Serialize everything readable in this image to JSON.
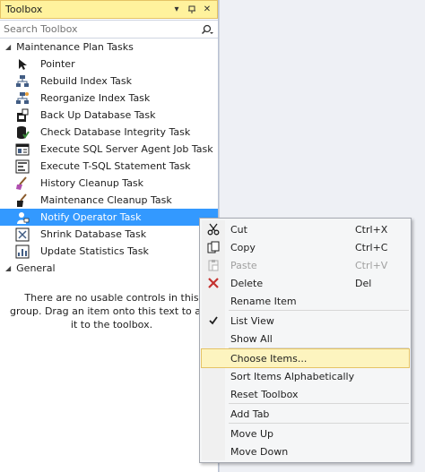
{
  "toolbox": {
    "title": "Toolbox",
    "pin_icon": "pin-icon",
    "close_label": "✕",
    "dropdown_label": "▾",
    "search": {
      "placeholder": "Search Toolbox"
    },
    "groups": [
      {
        "name": "Maintenance Plan Tasks",
        "items": [
          {
            "label": "Pointer",
            "icon": "pointer-icon"
          },
          {
            "label": "Rebuild Index Task",
            "icon": "rebuild-index-icon"
          },
          {
            "label": "Reorganize Index Task",
            "icon": "reorganize-index-icon"
          },
          {
            "label": "Back Up Database Task",
            "icon": "backup-database-icon"
          },
          {
            "label": "Check Database Integrity Task",
            "icon": "check-integrity-icon"
          },
          {
            "label": "Execute SQL Server Agent Job Task",
            "icon": "agent-job-icon"
          },
          {
            "label": "Execute T-SQL Statement Task",
            "icon": "tsql-icon"
          },
          {
            "label": "History Cleanup Task",
            "icon": "history-cleanup-icon"
          },
          {
            "label": "Maintenance Cleanup Task",
            "icon": "maintenance-cleanup-icon"
          },
          {
            "label": "Notify Operator Task",
            "icon": "notify-operator-icon",
            "selected": true
          },
          {
            "label": "Shrink Database Task",
            "icon": "shrink-database-icon"
          },
          {
            "label": "Update Statistics Task",
            "icon": "update-statistics-icon"
          }
        ]
      },
      {
        "name": "General",
        "empty_message": "There are no usable controls in this group. Drag an item onto this text to add it to the toolbox."
      }
    ]
  },
  "context_menu": {
    "items": [
      {
        "label": "Cut",
        "shortcut": "Ctrl+X",
        "icon": "cut-icon"
      },
      {
        "label": "Copy",
        "shortcut": "Ctrl+C",
        "icon": "copy-icon"
      },
      {
        "label": "Paste",
        "shortcut": "Ctrl+V",
        "icon": "paste-icon",
        "disabled": true
      },
      {
        "label": "Delete",
        "shortcut": "Del",
        "icon": "delete-icon"
      },
      {
        "label": "Rename Item"
      },
      {
        "label": "List View",
        "icon": "checkmark-icon",
        "checked": true
      },
      {
        "label": "Show All"
      },
      {
        "label": "Choose Items...",
        "hover": true
      },
      {
        "label": "Sort Items Alphabetically"
      },
      {
        "label": "Reset Toolbox"
      },
      {
        "label": "Add Tab"
      },
      {
        "label": "Move Up"
      },
      {
        "label": "Move Down"
      }
    ]
  }
}
